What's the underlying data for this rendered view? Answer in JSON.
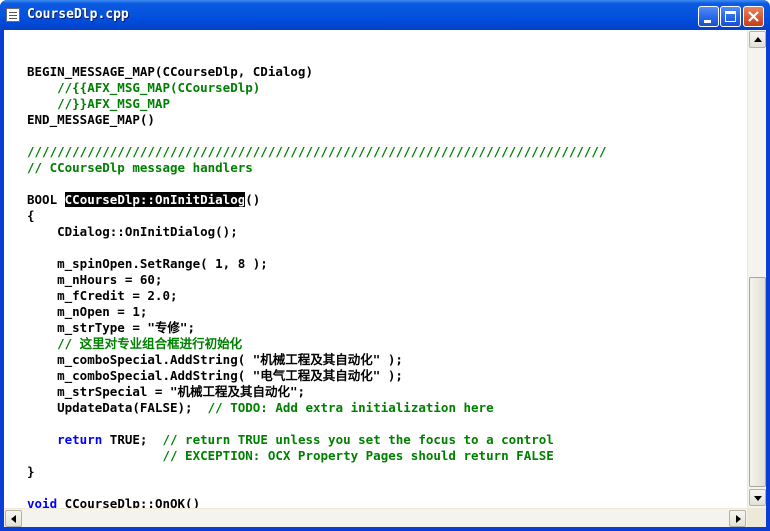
{
  "window": {
    "title": "CourseDlp.cpp"
  },
  "editor": {
    "lines": [
      {
        "text": "BEGIN_MESSAGE_MAP(CCourseDlp, CDialog)"
      },
      {
        "text": "    //{{AFX_MSG_MAP(CCourseDlp)"
      },
      {
        "text": "    //}}AFX_MSG_MAP"
      },
      {
        "text": "END_MESSAGE_MAP()"
      },
      {
        "text": "/////////////////////////////////////////////////////////////////////////////"
      },
      {
        "text": "// CCourseDlp message handlers"
      },
      {
        "pre": "BOOL ",
        "selected": "CCourseDlp::OnInitDialog",
        "post": "()"
      },
      {
        "text": "{"
      },
      {
        "text": "    CDialog::OnInitDialog();"
      },
      {
        "text": "    m_spinOpen.SetRange( 1, 8 );"
      },
      {
        "text": "    m_nHours = 60;"
      },
      {
        "text": "    m_fCredit = 2.0;"
      },
      {
        "text": "    m_nOpen = 1;"
      },
      {
        "text": "    m_strType = \"专修\";"
      },
      {
        "text": "    // 这里对专业组合框进行初始化"
      },
      {
        "text": "    m_comboSpecial.AddString( \"机械工程及其自动化\" );"
      },
      {
        "text": "    m_comboSpecial.AddString( \"电气工程及其自动化\" );"
      },
      {
        "text": "    m_strSpecial = \"机械工程及其自动化\";"
      },
      {
        "code": "    UpdateData(FALSE);  ",
        "comment": "// TODO: Add extra initialization here"
      },
      {
        "indent": "    ",
        "keyword": "return",
        "code": " TRUE;  ",
        "comment": "// return TRUE unless you set the focus to a control"
      },
      {
        "text": "                  // EXCEPTION: OCX Property Pages should return FALSE"
      },
      {
        "text": "}"
      },
      {
        "keyword": "void",
        "code": " CCourseDlp::OnOK()"
      }
    ]
  },
  "colors": {
    "keyword": "#0000ff",
    "comment": "#008000",
    "text": "#000000",
    "title_bar": "#0453de",
    "close_button": "#d8552c"
  },
  "icons": {
    "app": "document-icon",
    "minimize": "minimize-icon",
    "maximize": "maximize-icon",
    "close": "close-icon"
  },
  "scroll": {
    "vertical_position": 0.72
  }
}
